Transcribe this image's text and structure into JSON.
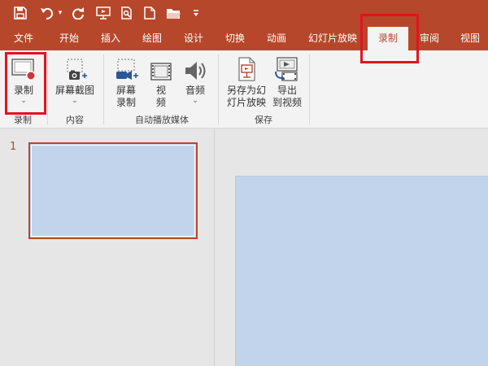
{
  "colors": {
    "accent": "#b7472a",
    "highlight": "#e0141e",
    "slide_fill": "#c2d3ec"
  },
  "quick_access": {
    "icons": [
      "save-icon",
      "undo-icon",
      "undo-dropdown-icon",
      "redo-icon",
      "from-beginning-icon",
      "print-preview-icon",
      "new-file-icon",
      "open-folder-icon",
      "customize-dropdown-icon"
    ]
  },
  "tabs": [
    {
      "label": "文件"
    },
    {
      "label": "开始"
    },
    {
      "label": "插入"
    },
    {
      "label": "绘图"
    },
    {
      "label": "设计"
    },
    {
      "label": "切换"
    },
    {
      "label": "动画"
    },
    {
      "label": "幻灯片放映"
    },
    {
      "label": "录制",
      "active": true
    },
    {
      "label": "审阅"
    },
    {
      "label": "视图"
    }
  ],
  "ribbon": {
    "groups": [
      {
        "label": "录制",
        "buttons": [
          {
            "line1": "录制",
            "chevron": "⌄"
          }
        ]
      },
      {
        "label": "内容",
        "buttons": [
          {
            "line1": "屏幕截图",
            "chevron": "⌄"
          }
        ]
      },
      {
        "label": "自动播放媒体",
        "buttons": [
          {
            "line1": "屏幕",
            "line2": "录制"
          },
          {
            "line1": "视",
            "line2": "频"
          },
          {
            "line1": "音频",
            "chevron": "⌄"
          }
        ]
      },
      {
        "label": "保存",
        "buttons": [
          {
            "line1": "另存为幻",
            "line2": "灯片放映"
          },
          {
            "line1": "导出",
            "line2": "到视频"
          }
        ]
      }
    ]
  },
  "slides": {
    "thumbnail_number": "1"
  }
}
